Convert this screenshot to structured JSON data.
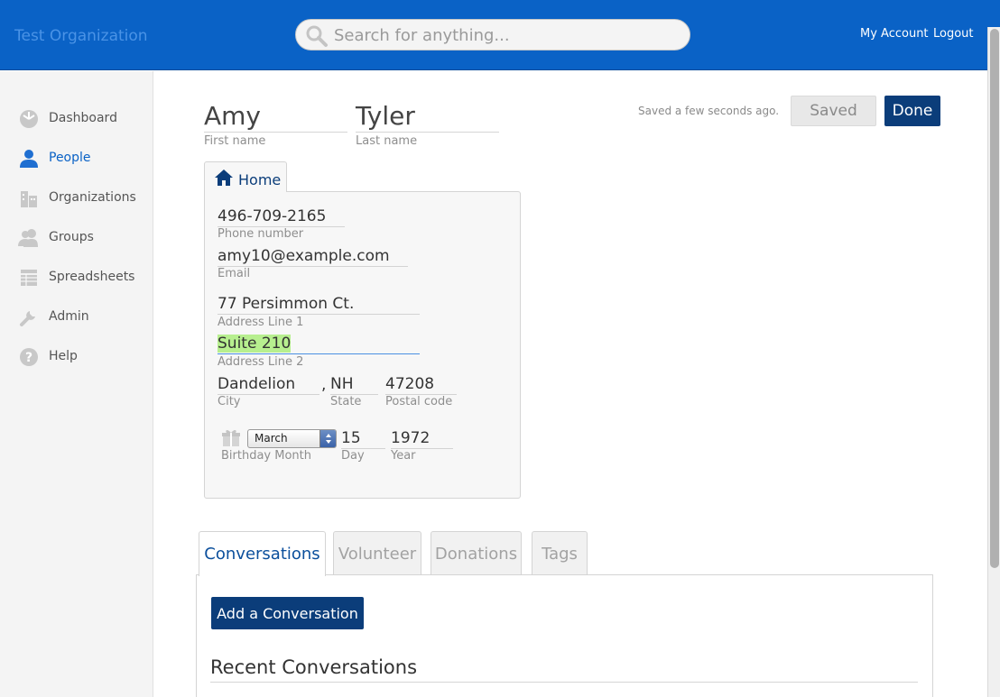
{
  "header": {
    "org_name": "Test Organization",
    "search_placeholder": "Search for anything...",
    "my_account": "My Account",
    "logout": "Logout"
  },
  "sidebar": {
    "items": [
      {
        "label": "Dashboard",
        "icon": "dashboard-icon",
        "active": false
      },
      {
        "label": "People",
        "icon": "person-icon",
        "active": true
      },
      {
        "label": "Organizations",
        "icon": "building-icon",
        "active": false
      },
      {
        "label": "Groups",
        "icon": "group-icon",
        "active": false
      },
      {
        "label": "Spreadsheets",
        "icon": "spreadsheet-icon",
        "active": false
      },
      {
        "label": "Admin",
        "icon": "wrench-icon",
        "active": false
      },
      {
        "label": "Help",
        "icon": "help-icon",
        "active": false
      }
    ]
  },
  "person": {
    "first_name": "Amy",
    "first_name_caption": "First name",
    "last_name": "Tyler",
    "last_name_caption": "Last name"
  },
  "status": {
    "saved_message": "Saved a few seconds ago.",
    "saved_button": "Saved",
    "done_button": "Done"
  },
  "home": {
    "tab_label": "Home",
    "phone": "496-709-2165",
    "phone_caption": "Phone number",
    "email": "amy10@example.com",
    "email_caption": "Email",
    "address1": "77 Persimmon Ct.",
    "address1_caption": "Address Line 1",
    "address2": "Suite 210",
    "address2_caption": "Address Line 2",
    "city": "Dandelion",
    "city_caption": "City",
    "comma": ",",
    "state": "NH",
    "state_caption": "State",
    "postal": "47208",
    "postal_caption": "Postal code",
    "birth_month": "March",
    "birth_month_caption": "Birthday Month",
    "birth_day": "15",
    "birth_day_caption": "Day",
    "birth_year": "1972",
    "birth_year_caption": "Year"
  },
  "tabs": [
    {
      "label": "Conversations",
      "active": true
    },
    {
      "label": "Volunteer",
      "active": false
    },
    {
      "label": "Donations",
      "active": false
    },
    {
      "label": "Tags",
      "active": false
    }
  ],
  "conversations": {
    "add_button": "Add a Conversation",
    "recent_title": "Recent Conversations"
  },
  "colors": {
    "header_blue": "#0a62c6",
    "primary_button": "#0b3d7a",
    "highlight": "#b7ef8f"
  }
}
